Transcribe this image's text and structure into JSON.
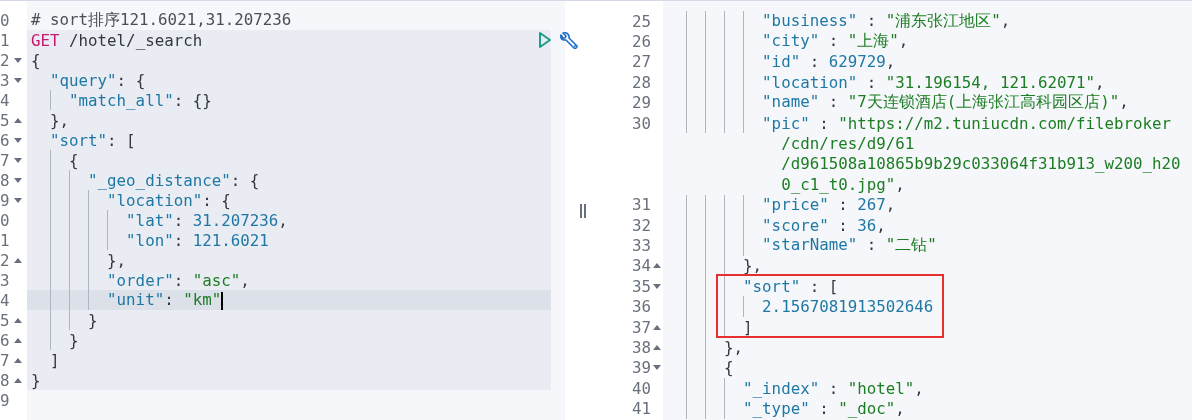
{
  "request_panel": {
    "lines": [
      {
        "number": "0",
        "in_request": false,
        "tokens": [
          {
            "kind": "comment",
            "text": "# sort排序121.6021,31.207236"
          }
        ]
      },
      {
        "number": "1",
        "in_request": true,
        "actions": true,
        "tokens": [
          {
            "kind": "method",
            "text": "GET"
          },
          {
            "kind": "url",
            "text": " /hotel/_search"
          }
        ]
      },
      {
        "number": "2",
        "in_request": true,
        "fold_start": true,
        "tokens": [
          {
            "kind": "punct",
            "text": "{"
          }
        ]
      },
      {
        "number": "3",
        "in_request": true,
        "fold_start": true,
        "tokens": [
          {
            "kind": "key",
            "text": "  \"query\""
          },
          {
            "kind": "punct",
            "text": ": {"
          }
        ]
      },
      {
        "number": "4",
        "in_request": true,
        "tokens": [
          {
            "kind": "key",
            "text": "    \"match_all\""
          },
          {
            "kind": "punct",
            "text": ": {}"
          }
        ]
      },
      {
        "number": "5",
        "in_request": true,
        "fold_end": true,
        "tokens": [
          {
            "kind": "punct",
            "text": "  },"
          }
        ]
      },
      {
        "number": "6",
        "in_request": true,
        "fold_start": true,
        "tokens": [
          {
            "kind": "key",
            "text": "  \"sort\""
          },
          {
            "kind": "punct",
            "text": ": ["
          }
        ]
      },
      {
        "number": "7",
        "in_request": true,
        "fold_start": true,
        "tokens": [
          {
            "kind": "punct",
            "text": "    {"
          }
        ]
      },
      {
        "number": "8",
        "in_request": true,
        "fold_start": true,
        "tokens": [
          {
            "kind": "key",
            "text": "      \"_geo_distance\""
          },
          {
            "kind": "punct",
            "text": ": {"
          }
        ]
      },
      {
        "number": "9",
        "in_request": true,
        "fold_start": true,
        "tokens": [
          {
            "kind": "key",
            "text": "        \"location\""
          },
          {
            "kind": "punct",
            "text": ": {"
          }
        ]
      },
      {
        "number": "0",
        "in_request": true,
        "tokens": [
          {
            "kind": "key",
            "text": "          \"lat\""
          },
          {
            "kind": "punct",
            "text": ": "
          },
          {
            "kind": "number",
            "text": "31.207236"
          },
          {
            "kind": "punct",
            "text": ","
          }
        ]
      },
      {
        "number": "1",
        "in_request": true,
        "tokens": [
          {
            "kind": "key",
            "text": "          \"lon\""
          },
          {
            "kind": "punct",
            "text": ": "
          },
          {
            "kind": "number",
            "text": "121.6021"
          }
        ]
      },
      {
        "number": "2",
        "in_request": true,
        "fold_end": true,
        "tokens": [
          {
            "kind": "punct",
            "text": "        },"
          }
        ]
      },
      {
        "number": "3",
        "in_request": true,
        "tokens": [
          {
            "kind": "key",
            "text": "        \"order\""
          },
          {
            "kind": "punct",
            "text": ": "
          },
          {
            "kind": "string",
            "text": "\"asc\""
          },
          {
            "kind": "punct",
            "text": ","
          }
        ]
      },
      {
        "number": "4",
        "in_request": true,
        "active": true,
        "tokens": [
          {
            "kind": "key",
            "text": "        \"unit\""
          },
          {
            "kind": "punct",
            "text": ": "
          },
          {
            "kind": "string",
            "text": "\"km\""
          }
        ]
      },
      {
        "number": "5",
        "in_request": true,
        "fold_end": true,
        "tokens": [
          {
            "kind": "punct",
            "text": "      }"
          }
        ]
      },
      {
        "number": "6",
        "in_request": true,
        "fold_end": true,
        "tokens": [
          {
            "kind": "punct",
            "text": "    }"
          }
        ]
      },
      {
        "number": "7",
        "in_request": true,
        "fold_end": true,
        "tokens": [
          {
            "kind": "punct",
            "text": "  ]"
          }
        ]
      },
      {
        "number": "8",
        "in_request": true,
        "fold_end": true,
        "tokens": [
          {
            "kind": "punct",
            "text": "}"
          }
        ]
      },
      {
        "number": "9",
        "in_request": false
      }
    ]
  },
  "response_panel": {
    "lines": [
      {
        "number": "25",
        "tokens": [
          {
            "kind": "key",
            "text": "          \"business\""
          },
          {
            "kind": "punct",
            "text": " : "
          },
          {
            "kind": "string",
            "text": "\"浦东张江地区\""
          },
          {
            "kind": "punct",
            "text": ","
          }
        ]
      },
      {
        "number": "26",
        "tokens": [
          {
            "kind": "key",
            "text": "          \"city\""
          },
          {
            "kind": "punct",
            "text": " : "
          },
          {
            "kind": "string",
            "text": "\"上海\""
          },
          {
            "kind": "punct",
            "text": ","
          }
        ]
      },
      {
        "number": "27",
        "tokens": [
          {
            "kind": "key",
            "text": "          \"id\""
          },
          {
            "kind": "punct",
            "text": " : "
          },
          {
            "kind": "number",
            "text": "629729"
          },
          {
            "kind": "punct",
            "text": ","
          }
        ]
      },
      {
        "number": "28",
        "tokens": [
          {
            "kind": "key",
            "text": "          \"location\""
          },
          {
            "kind": "punct",
            "text": " : "
          },
          {
            "kind": "string",
            "text": "\"31.196154, 121.62071\""
          },
          {
            "kind": "punct",
            "text": ","
          }
        ]
      },
      {
        "number": "29",
        "tokens": [
          {
            "kind": "key",
            "text": "          \"name\""
          },
          {
            "kind": "punct",
            "text": " : "
          },
          {
            "kind": "string",
            "text": "\"7天连锁酒店(上海张江高科园区店)\""
          },
          {
            "kind": "punct",
            "text": ","
          }
        ]
      },
      {
        "number": "30",
        "tokens": [
          {
            "kind": "key",
            "text": "          \"pic\""
          },
          {
            "kind": "punct",
            "text": " : "
          },
          {
            "kind": "string",
            "text": "\"https://m2.tuniucdn.com/filebroker"
          }
        ]
      },
      {
        "wrap": true,
        "tokens": [
          {
            "kind": "string",
            "text": "            /cdn/res/d9/61"
          }
        ]
      },
      {
        "wrap": true,
        "tokens": [
          {
            "kind": "string",
            "text": "            /d961508a10865b9b29c033064f31b913_w200_h20"
          }
        ]
      },
      {
        "wrap": true,
        "tokens": [
          {
            "kind": "string",
            "text": "            0_c1_t0.jpg\""
          },
          {
            "kind": "punct",
            "text": ","
          }
        ]
      },
      {
        "number": "31",
        "tokens": [
          {
            "kind": "key",
            "text": "          \"price\""
          },
          {
            "kind": "punct",
            "text": " : "
          },
          {
            "kind": "number",
            "text": "267"
          },
          {
            "kind": "punct",
            "text": ","
          }
        ]
      },
      {
        "number": "32",
        "tokens": [
          {
            "kind": "key",
            "text": "          \"score\""
          },
          {
            "kind": "punct",
            "text": " : "
          },
          {
            "kind": "number",
            "text": "36"
          },
          {
            "kind": "punct",
            "text": ","
          }
        ]
      },
      {
        "number": "33",
        "tokens": [
          {
            "kind": "key",
            "text": "          \"starName\""
          },
          {
            "kind": "punct",
            "text": " : "
          },
          {
            "kind": "string",
            "text": "\"二钻\""
          }
        ]
      },
      {
        "number": "34",
        "fold_end": true,
        "tokens": [
          {
            "kind": "punct",
            "text": "        },"
          }
        ]
      },
      {
        "number": "35",
        "fold_start": true,
        "boxed": true,
        "tokens": [
          {
            "kind": "key",
            "text": "        \"sort\""
          },
          {
            "kind": "punct",
            "text": " : ["
          }
        ]
      },
      {
        "number": "36",
        "boxed": true,
        "tokens": [
          {
            "kind": "number",
            "text": "          2.1567081913502646"
          }
        ]
      },
      {
        "number": "37",
        "fold_end": true,
        "boxed": true,
        "tokens": [
          {
            "kind": "punct",
            "text": "        ]"
          }
        ]
      },
      {
        "number": "38",
        "fold_end": true,
        "tokens": [
          {
            "kind": "punct",
            "text": "      },"
          }
        ]
      },
      {
        "number": "39",
        "fold_start": true,
        "tokens": [
          {
            "kind": "punct",
            "text": "      {"
          }
        ]
      },
      {
        "number": "40",
        "tokens": [
          {
            "kind": "key",
            "text": "        \"_index\""
          },
          {
            "kind": "punct",
            "text": " : "
          },
          {
            "kind": "string",
            "text": "\"hotel\""
          },
          {
            "kind": "punct",
            "text": ","
          }
        ]
      },
      {
        "number": "41",
        "tokens": [
          {
            "kind": "key",
            "text": "        \"_type\""
          },
          {
            "kind": "punct",
            "text": " : "
          },
          {
            "kind": "string",
            "text": "\"_doc\""
          },
          {
            "kind": "punct",
            "text": ","
          }
        ]
      }
    ]
  }
}
